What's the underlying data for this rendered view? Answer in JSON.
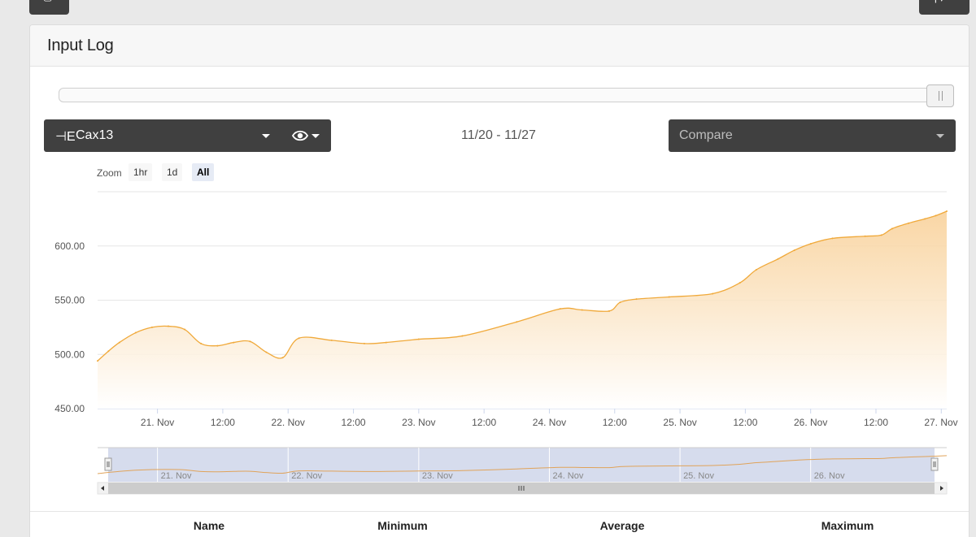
{
  "toolbar": {
    "left_icon": "camera-icon",
    "right_icon": "settings-icon"
  },
  "panel": {
    "title": "Input Log"
  },
  "signal_selector": {
    "icon": "signal-icon",
    "icon_glyph": "⊣E",
    "selected": "Cax13",
    "view_icon": "eye-icon"
  },
  "date_range": "11/20 - 11/27",
  "compare": {
    "placeholder": "Compare"
  },
  "zoom": {
    "label": "Zoom",
    "options": [
      "1hr",
      "1d",
      "All"
    ],
    "active": "All"
  },
  "colors": {
    "accent": "#f0a93a",
    "fill_top": "#f8cf95",
    "navigator_mask": "#cfd6ea",
    "button_dark": "#404040"
  },
  "chart_data": {
    "type": "area",
    "y_ticks": [
      "450.00",
      "500.00",
      "550.00",
      "600.00"
    ],
    "ylim": [
      450,
      650
    ],
    "x_tick_labels": [
      "21. Nov",
      "12:00",
      "22. Nov",
      "12:00",
      "23. Nov",
      "12:00",
      "24. Nov",
      "12:00",
      "25. Nov",
      "12:00",
      "26. Nov",
      "12:00",
      "27. Nov"
    ],
    "x_tick_hours": [
      24,
      36,
      48,
      60,
      72,
      84,
      96,
      108,
      120,
      132,
      144,
      156,
      168
    ],
    "series": [
      {
        "x_hours": [
          13,
          15,
          17,
          20,
          23,
          26,
          29,
          32,
          35,
          38,
          41,
          44,
          47,
          50,
          56,
          62,
          66,
          72,
          80,
          90,
          98,
          102,
          107,
          109,
          112,
          118,
          126,
          131,
          134,
          138,
          141,
          144,
          148,
          154,
          157,
          159,
          162,
          165,
          167,
          169
        ],
        "values": [
          494,
          503,
          511,
          520,
          525,
          526,
          523,
          510,
          508,
          511,
          512,
          502,
          497,
          515,
          513,
          510,
          511,
          514,
          517,
          530,
          542,
          541,
          540,
          548,
          551,
          553,
          556,
          566,
          578,
          588,
          596,
          602,
          607,
          609,
          610,
          616,
          621,
          625,
          628,
          632
        ]
      }
    ],
    "navigator_labels": [
      "21. Nov",
      "22. Nov",
      "23. Nov",
      "24. Nov",
      "25. Nov",
      "26. Nov"
    ],
    "navigator_label_hours": [
      24,
      48,
      72,
      96,
      120,
      144
    ]
  },
  "stats_table": {
    "columns": [
      "Name",
      "Minimum",
      "Average",
      "Maximum"
    ]
  }
}
